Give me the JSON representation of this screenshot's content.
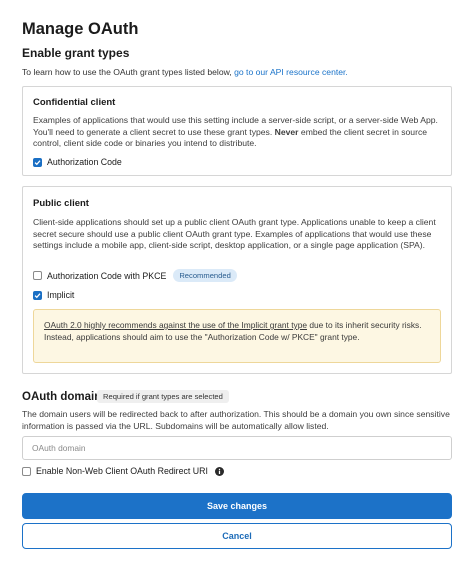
{
  "page": {
    "title": "Manage OAuth"
  },
  "grant_types": {
    "heading": "Enable grant types",
    "intro_text": "To learn how to use the OAuth grant types listed below,",
    "intro_link": "go to our API resource center."
  },
  "confidential": {
    "title": "Confidential client",
    "desc_part1": "Examples of applications that would use this setting include a server-side script, or a server-side Web App. You'll need to generate a client secret to use these grant types.",
    "desc_bold": "Never",
    "desc_part2": "embed the client secret in source control, client side code or binaries you intend to distribute.",
    "auth_code": {
      "label": "Authorization Code",
      "checked": true
    }
  },
  "public": {
    "title": "Public client",
    "desc": "Client-side applications should set up a public client OAuth grant type. Applications unable to keep a client secret secure should use a public client OAuth grant type. Examples of applications that would use these settings include a mobile app, client-side script, desktop application, or a single page application (SPA).",
    "pkce": {
      "label": "Authorization Code with PKCE",
      "badge": "Recommended",
      "checked": false
    },
    "implicit": {
      "label": "Implicit",
      "checked": true
    },
    "warning": {
      "link": "OAuth 2.0 highly recommends against the use of the Implicit grant type",
      "text1": "due to its inherit security risks.",
      "text2": "Instead, applications should aim to use the \"Authorization Code w/ PKCE\" grant type."
    }
  },
  "domain": {
    "heading": "OAuth domain",
    "required_badge": "Required if grant types are selected",
    "desc": "The domain users will be redirected back to after authorization. This should be a domain you own since sensitive information is passed via the URL. Subdomains will be automatically allow listed.",
    "input_placeholder": "OAuth domain",
    "input_value": ""
  },
  "non_web": {
    "label": "Enable Non-Web Client OAuth Redirect URI",
    "checked": false,
    "icon": "info-icon"
  },
  "actions": {
    "save_label": "Save changes",
    "cancel_label": "Cancel"
  },
  "colors": {
    "primary": "#1c72c8",
    "warning_bg": "#fdf7e3",
    "badge_bg": "#dbeaf8"
  }
}
